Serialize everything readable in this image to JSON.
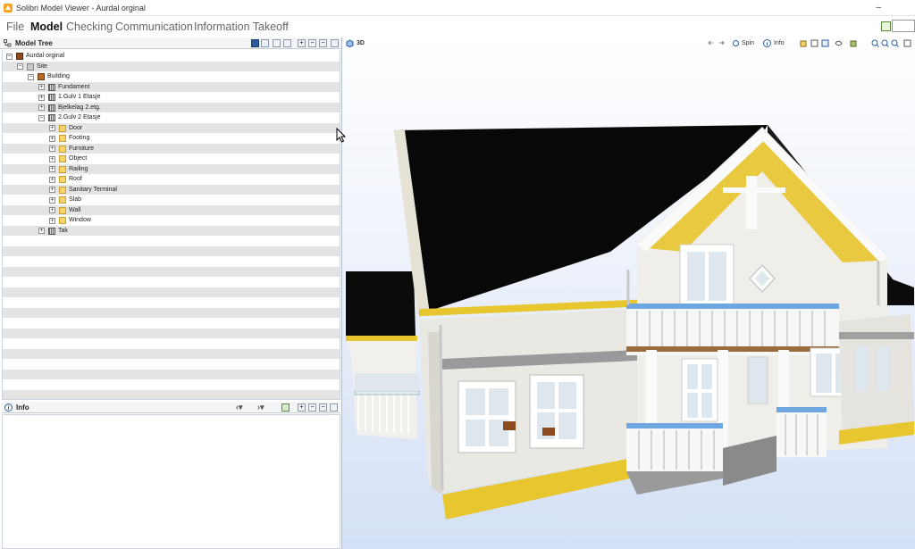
{
  "window": {
    "title": "Solibri Model Viewer - Aurdal orginal",
    "controls": "–"
  },
  "menu": [
    "File",
    "Model",
    "Checking",
    "Communication",
    "Information Takeoff"
  ],
  "menu_active": "Model",
  "model_tree": {
    "title": "Model Tree",
    "rows": [
      {
        "label": "Aurdal orginal",
        "icon": "model-icon",
        "expander": "−",
        "level": 0
      },
      {
        "label": "Site",
        "icon": "site-icon",
        "expander": "−",
        "level": 1
      },
      {
        "label": "Building",
        "icon": "building-icon",
        "expander": "−",
        "level": 2
      },
      {
        "label": "Fundament",
        "icon": "storey-icon",
        "expander": "+",
        "level": 3
      },
      {
        "label": "1.Gulv 1 Etasje",
        "icon": "storey-icon",
        "expander": "+",
        "level": 3
      },
      {
        "label": "Bjelkelag 2.etg.",
        "icon": "storey-icon",
        "expander": "+",
        "level": 3
      },
      {
        "label": "2.Gulv 2 Etasje",
        "icon": "storey-icon",
        "expander": "−",
        "level": 3
      },
      {
        "label": "Door",
        "icon": "folder-icon",
        "expander": "+",
        "level": 4
      },
      {
        "label": "Footing",
        "icon": "folder-icon",
        "expander": "+",
        "level": 4
      },
      {
        "label": "Furniture",
        "icon": "folder-icon",
        "expander": "+",
        "level": 4
      },
      {
        "label": "Object",
        "icon": "folder-icon",
        "expander": "+",
        "level": 4
      },
      {
        "label": "Railing",
        "icon": "folder-icon",
        "expander": "+",
        "level": 4
      },
      {
        "label": "Roof",
        "icon": "folder-icon",
        "expander": "+",
        "level": 4
      },
      {
        "label": "Sanitary Terminal",
        "icon": "folder-icon",
        "expander": "+",
        "level": 4
      },
      {
        "label": "Slab",
        "icon": "folder-icon",
        "expander": "+",
        "level": 4
      },
      {
        "label": "Wall",
        "icon": "folder-icon",
        "expander": "+",
        "level": 4
      },
      {
        "label": "Window",
        "icon": "folder-icon",
        "expander": "+",
        "level": 4
      },
      {
        "label": "Tak",
        "icon": "storey-icon",
        "expander": "+",
        "level": 3
      }
    ]
  },
  "info_panel": {
    "title": "Info"
  },
  "viewer": {
    "label": "3D",
    "spin_label": "Spin",
    "info_label": "Info"
  },
  "colors": {
    "accent": "#2b5a9e",
    "roof": "#0a0a0a",
    "trim_yellow": "#e8c630",
    "wall": "#ecebe6",
    "railing_blue": "#6ea6e0"
  }
}
